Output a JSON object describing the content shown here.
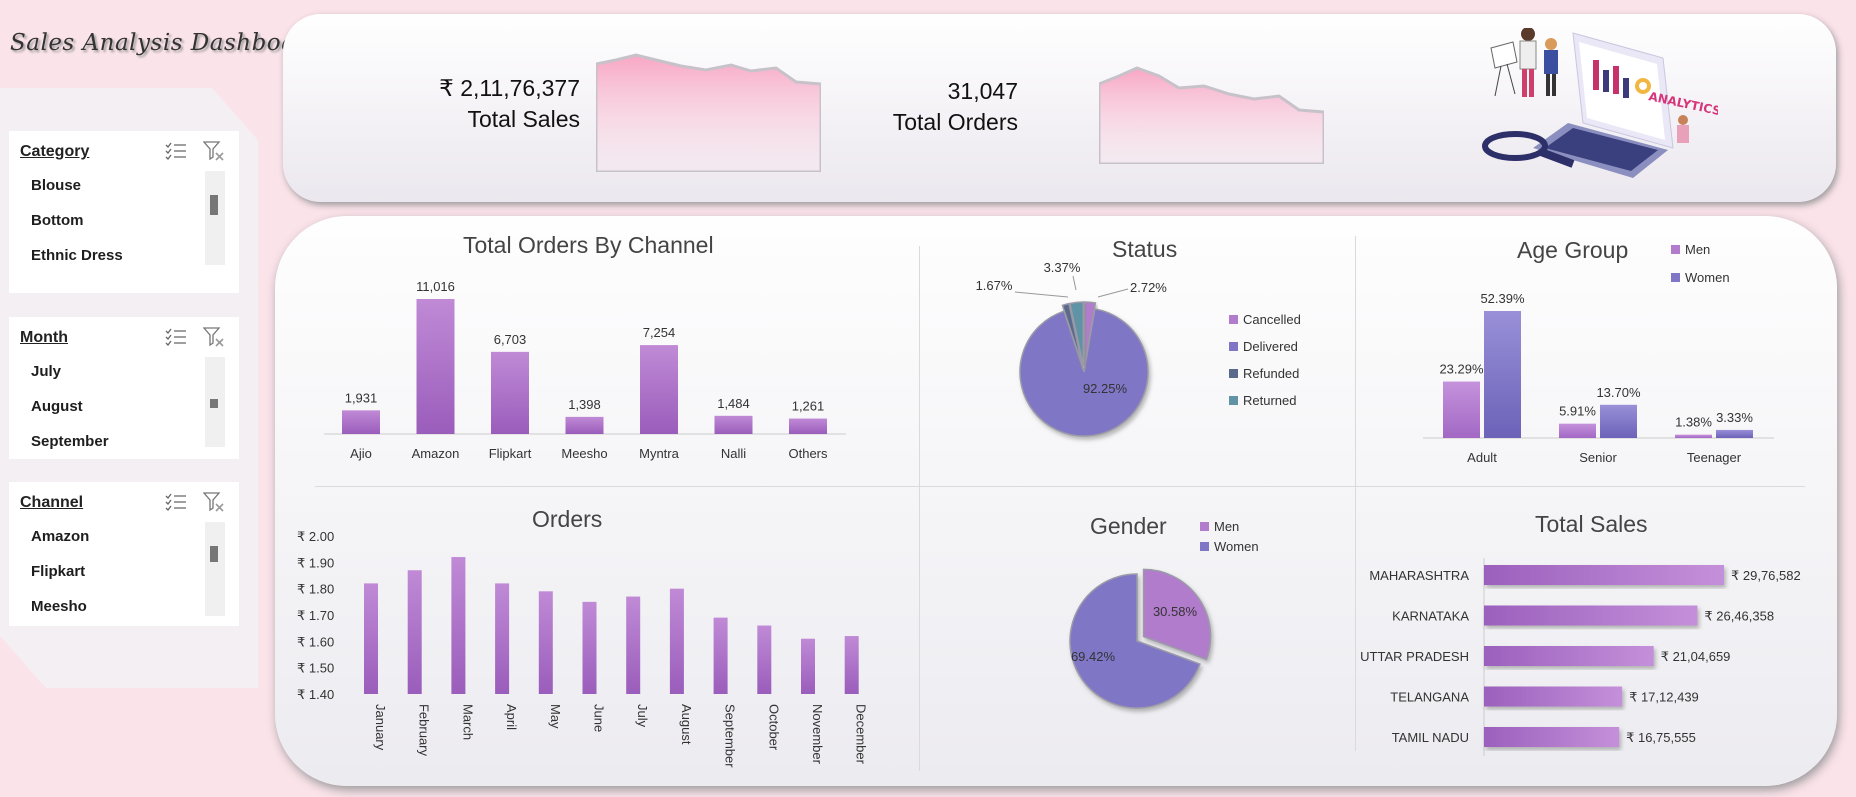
{
  "app": {
    "title": "Sales Analysis Dashboard"
  },
  "slicers": [
    {
      "title": "Category",
      "items": [
        "Blouse",
        "Bottom",
        "Ethnic Dress"
      ]
    },
    {
      "title": "Month",
      "items": [
        "July",
        "August",
        "September"
      ]
    },
    {
      "title": "Channel ",
      "items": [
        "Amazon",
        "Flipkart",
        "Meesho"
      ]
    }
  ],
  "kpis": {
    "sales": {
      "value": "₹ 2,11,76,377",
      "label": "Total Sales"
    },
    "orders": {
      "value": "31,047",
      "label": "Total Orders"
    }
  },
  "illustration": {
    "text": "ANALYTICS"
  },
  "colors": {
    "bar": "#a66fc4",
    "women": "#7f76c6",
    "men": "#b27ccc",
    "background": "#fbe3ea"
  },
  "chart_data": [
    {
      "id": "orders_by_channel",
      "type": "bar",
      "title": "Total Orders By Channel",
      "categories": [
        "Ajio",
        "Amazon",
        "Flipkart",
        "Meesho",
        "Myntra",
        "Nalli",
        "Others"
      ],
      "values": [
        1931,
        11016,
        6703,
        1398,
        7254,
        1484,
        1261
      ],
      "value_labels": [
        "1,931",
        "11,016",
        "6,703",
        "1,398",
        "7,254",
        "1,484",
        "1,261"
      ],
      "ylim": [
        0,
        11016
      ]
    },
    {
      "id": "status",
      "type": "pie",
      "title": "Status",
      "labels": [
        "Cancelled",
        "Delivered",
        "Refunded",
        "Returned"
      ],
      "values": [
        2.72,
        92.25,
        1.67,
        3.37
      ],
      "value_labels": [
        "2.72%",
        "92.25%",
        "1.67%",
        "3.37%"
      ],
      "colors": [
        "#b27ccc",
        "#7f76c6",
        "#5a6a8c",
        "#5f93a5"
      ],
      "legend": "right"
    },
    {
      "id": "age_group",
      "type": "bar",
      "title": "Age Group",
      "categories": [
        "Adult",
        "Senior",
        "Teenager"
      ],
      "series": [
        {
          "name": "Men",
          "values": [
            23.29,
            5.91,
            1.38
          ],
          "labels": [
            "23.29%",
            "5.91%",
            "1.38%"
          ]
        },
        {
          "name": "Women",
          "values": [
            52.39,
            13.7,
            3.33
          ],
          "labels": [
            "52.39%",
            "13.70%",
            "3.33%"
          ]
        }
      ],
      "legend": "top-right"
    },
    {
      "id": "orders_by_month",
      "type": "bar",
      "title": "Orders",
      "categories": [
        "January",
        "February",
        "March",
        "April",
        "May",
        "June",
        "July",
        "August",
        "September",
        "October",
        "November",
        "December"
      ],
      "values": [
        1.82,
        1.87,
        1.92,
        1.82,
        1.79,
        1.75,
        1.77,
        1.8,
        1.69,
        1.66,
        1.61,
        1.62
      ],
      "yticks": [
        "₹ 2.00",
        "₹ 1.90",
        "₹ 1.80",
        "₹ 1.70",
        "₹ 1.60",
        "₹ 1.50",
        "₹ 1.40"
      ],
      "ylim": [
        1.4,
        2.0
      ]
    },
    {
      "id": "gender",
      "type": "pie",
      "title": "Gender",
      "labels": [
        "Men",
        "Women"
      ],
      "values": [
        30.58,
        69.42
      ],
      "value_labels": [
        "30.58%",
        "69.42%"
      ],
      "colors": [
        "#b27ccc",
        "#7f76c6"
      ],
      "legend": "top-right"
    },
    {
      "id": "sales_by_state",
      "type": "bar",
      "orientation": "horizontal",
      "title": "Total Sales",
      "categories": [
        "MAHARASHTRA",
        "KARNATAKA",
        "UTTAR PRADESH",
        "TELANGANA",
        "TAMIL NADU"
      ],
      "values": [
        2976582,
        2646358,
        2104659,
        1712439,
        1675555
      ],
      "value_labels": [
        "₹ 29,76,582",
        "₹ 26,46,358",
        "₹ 21,04,659",
        "₹ 17,12,439",
        "₹ 16,75,555"
      ]
    }
  ]
}
